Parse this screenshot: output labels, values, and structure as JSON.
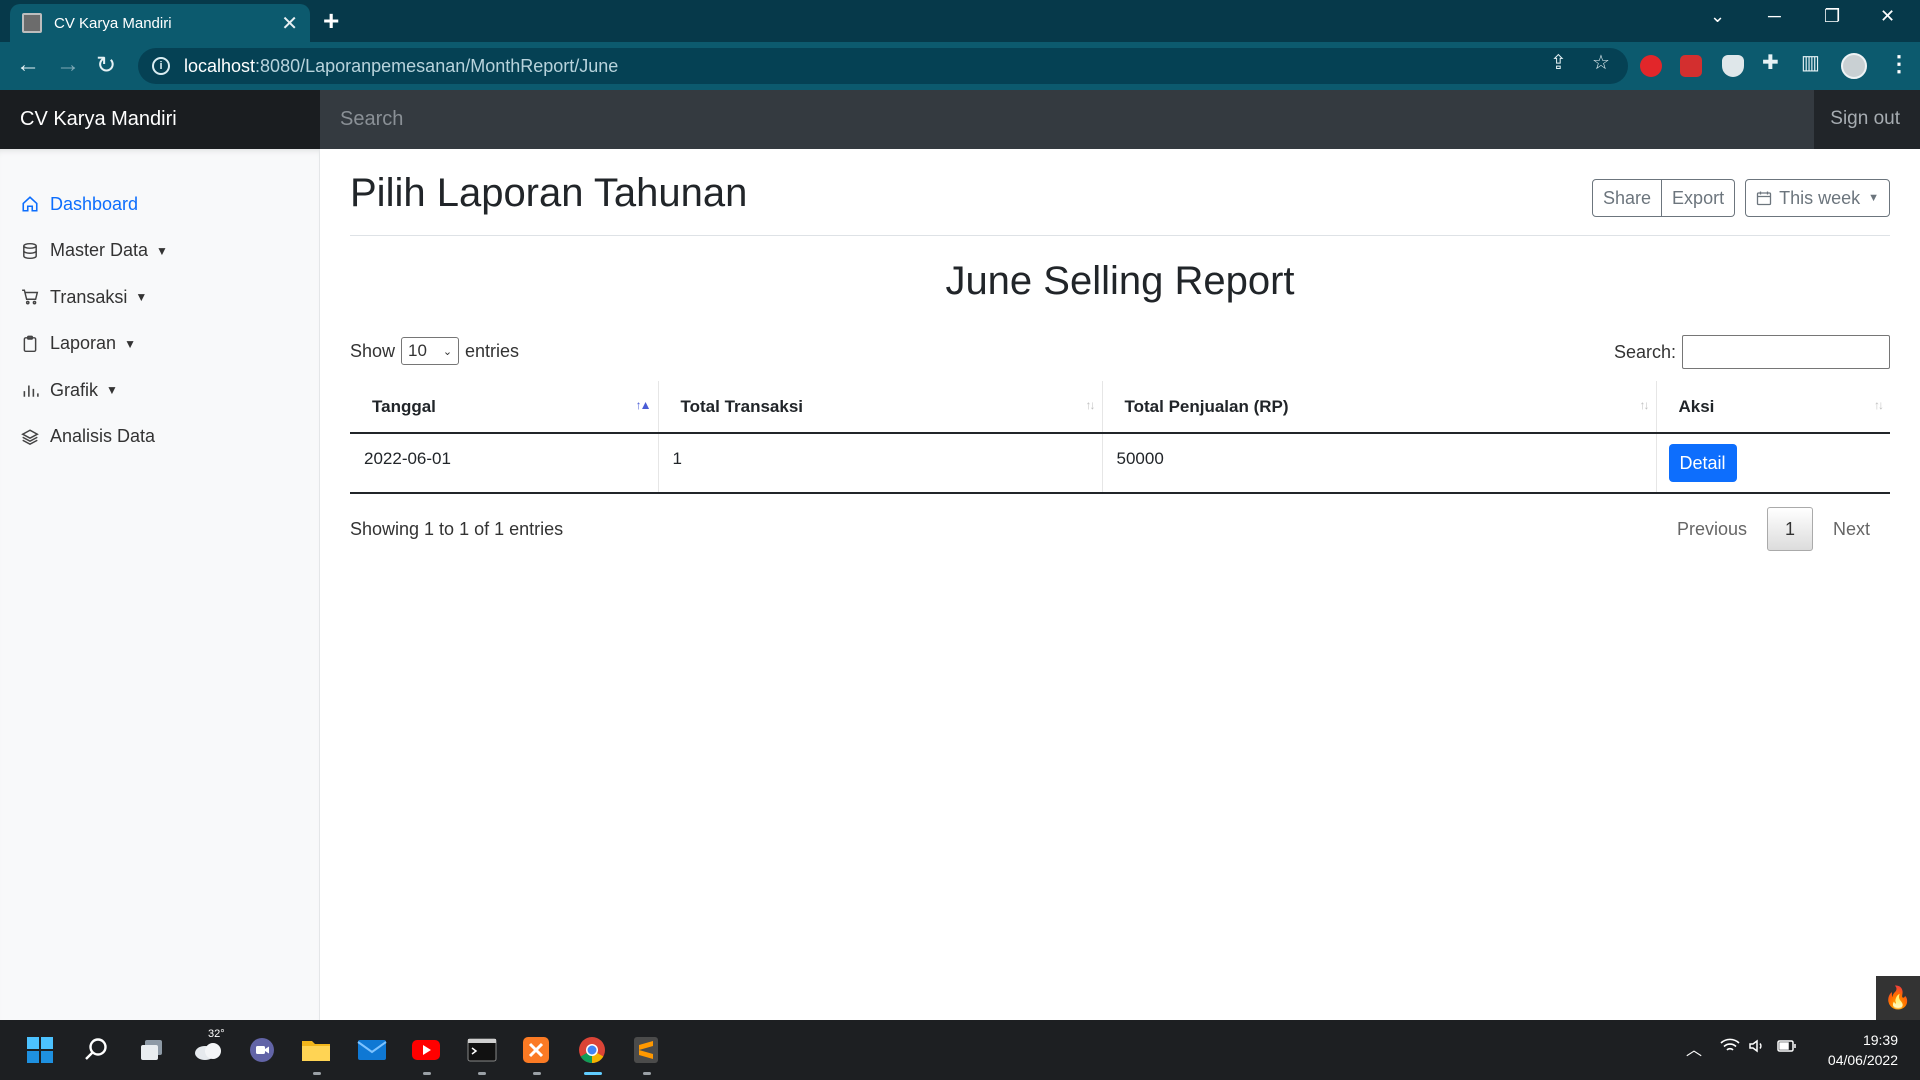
{
  "browser": {
    "tab_title": "CV Karya Mandiri",
    "url_host": "localhost",
    "url_path": ":8080/Laporanpemesanan/MonthReport/June"
  },
  "navbar": {
    "brand": "CV Karya Mandiri",
    "search_placeholder": "Search",
    "signout": "Sign out"
  },
  "sidebar": {
    "items": [
      {
        "label": "Dashboard",
        "icon": "home-icon",
        "active": true
      },
      {
        "label": "Master Data",
        "icon": "database-icon",
        "dropdown": true
      },
      {
        "label": "Transaksi",
        "icon": "cart-icon",
        "dropdown": true
      },
      {
        "label": "Laporan",
        "icon": "clipboard-icon",
        "dropdown": true
      },
      {
        "label": "Grafik",
        "icon": "bar-chart-icon",
        "dropdown": true
      },
      {
        "label": "Analisis Data",
        "icon": "layers-icon"
      }
    ]
  },
  "main": {
    "page_title": "Pilih Laporan Tahunan",
    "buttons": {
      "share": "Share",
      "export": "Export",
      "this_week": "This week"
    },
    "report_title": "June Selling Report",
    "show_label": "Show",
    "entries_value": "10",
    "entries_label": "entries",
    "search_label": "Search:",
    "table": {
      "headers": [
        "Tanggal",
        "Total Transaksi",
        "Total Penjualan (RP)",
        "Aksi"
      ],
      "rows": [
        {
          "tanggal": "2022-06-01",
          "total_transaksi": "1",
          "total_penjualan": "50000",
          "aksi": "Detail"
        }
      ]
    },
    "info": "Showing 1 to 1 of 1 entries",
    "pagination": {
      "previous": "Previous",
      "current": "1",
      "next": "Next"
    }
  },
  "taskbar": {
    "weather_temp": "32°",
    "time": "19:39",
    "date": "04/06/2022"
  }
}
